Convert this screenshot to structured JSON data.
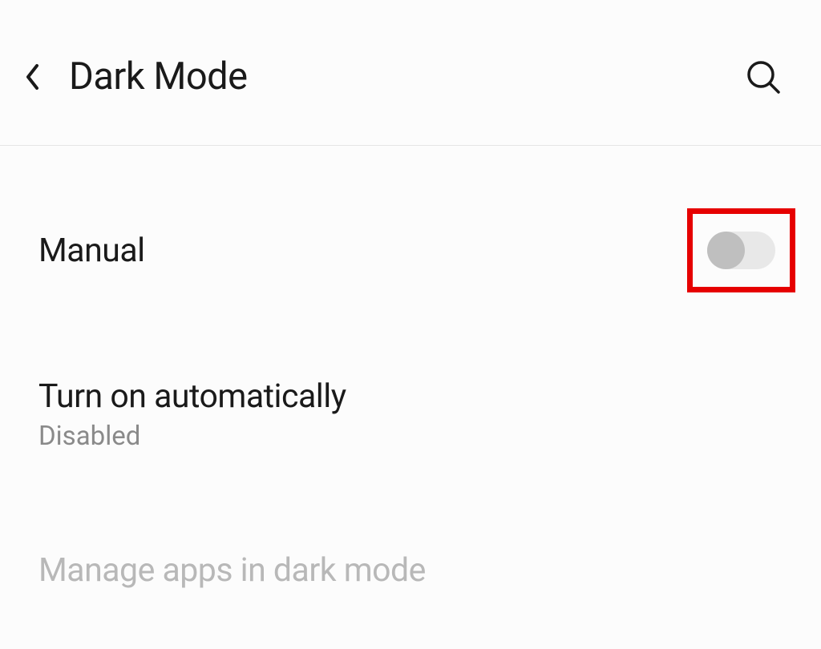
{
  "header": {
    "title": "Dark Mode"
  },
  "settings": {
    "manual": {
      "label": "Manual",
      "toggled": false
    },
    "auto": {
      "label": "Turn on automatically",
      "status": "Disabled"
    },
    "manage": {
      "label": "Manage apps in dark mode"
    }
  }
}
